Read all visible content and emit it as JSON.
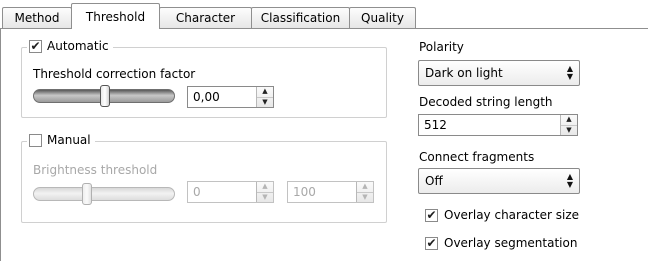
{
  "tabs": [
    {
      "label": "Method"
    },
    {
      "label": "Threshold"
    },
    {
      "label": "Character"
    },
    {
      "label": "Classification"
    },
    {
      "label": "Quality"
    }
  ],
  "active_tab": "Threshold",
  "automatic": {
    "label": "Automatic",
    "checked": true,
    "factor_label": "Threshold correction factor",
    "factor_value": "0,00",
    "slider_level": 0.5
  },
  "manual": {
    "label": "Manual",
    "checked": false,
    "brightness_label": "Brightness threshold",
    "low_value": "0",
    "high_value": "100",
    "slider_level": 0.4
  },
  "polarity": {
    "label": "Polarity",
    "value": "Dark on light"
  },
  "decoded_length": {
    "label": "Decoded string length",
    "value": "512"
  },
  "connect_fragments": {
    "label": "Connect fragments",
    "value": "Off"
  },
  "overlay_character_size": {
    "label": "Overlay character size",
    "checked": true
  },
  "overlay_segmentation": {
    "label": "Overlay segmentation",
    "checked": true
  },
  "icons": {
    "check": "✔",
    "spin_up": "▲",
    "spin_down": "▼",
    "combo_arrows": "up-down-arrows"
  }
}
